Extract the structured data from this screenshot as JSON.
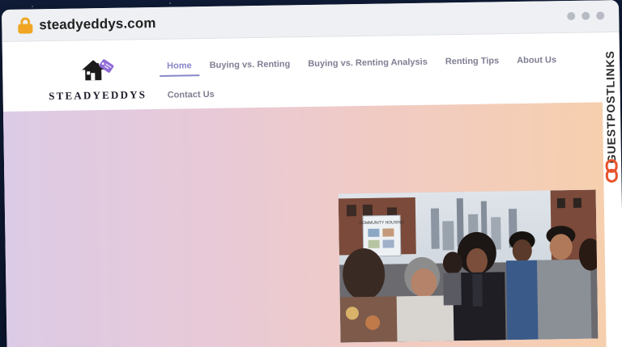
{
  "browser": {
    "url": "steadyeddys.com"
  },
  "site": {
    "logo_text": "STEADYEDDYS",
    "nav": [
      {
        "label": "Home",
        "active": true
      },
      {
        "label": "Buying vs. Renting",
        "active": false
      },
      {
        "label": "Buying vs. Renting Analysis",
        "active": false
      },
      {
        "label": "Renting Tips",
        "active": false
      },
      {
        "label": "About Us",
        "active": false
      },
      {
        "label": "Contact Us",
        "active": false
      }
    ],
    "accent_color": "#8a86c9"
  },
  "overlay": {
    "brand_label": "GUESTPOSTLINKS",
    "brand_color": "#e8532b"
  },
  "hero": {
    "gradient_colors": [
      "#dccbe6",
      "#e8c9d7",
      "#f1cbc2",
      "#f6cfae"
    ],
    "photo_sign_text": "COMMUNITY HOUSING"
  }
}
